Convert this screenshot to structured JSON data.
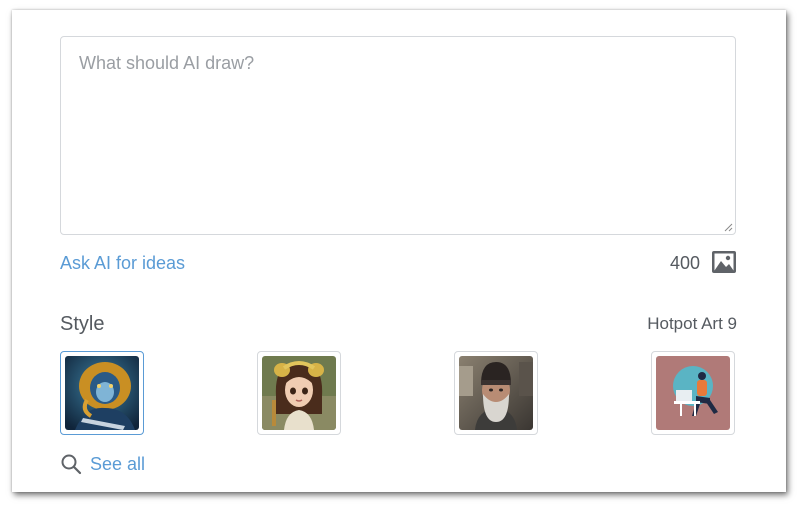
{
  "prompt": {
    "placeholder": "What should AI draw?",
    "value": ""
  },
  "ideas_link": "Ask AI for ideas",
  "char_count": "400",
  "style": {
    "label": "Style",
    "selected_name": "Hotpot Art 9",
    "thumbnails": [
      {
        "subject": "lion-warrior-painting",
        "selected": true
      },
      {
        "subject": "cartoon-girl-3d",
        "selected": false
      },
      {
        "subject": "bearded-man-photo",
        "selected": false
      },
      {
        "subject": "person-laptop-flat-illustration",
        "selected": false
      }
    ]
  },
  "see_all": "See all",
  "colors": {
    "link": "#5a9bd5",
    "text": "#555a60",
    "placeholder": "#9a9ea3",
    "border": "#d5d8dc"
  }
}
